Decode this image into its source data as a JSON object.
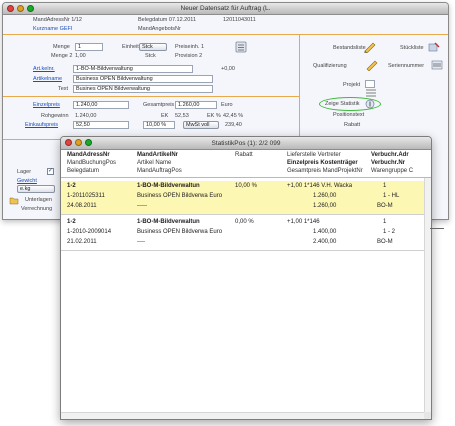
{
  "back_window": {
    "title": "Neuer Datensatz für Auftrag (L.",
    "top": {
      "mandadressnr": "MandAdressNr 1/12",
      "belegdatum": "Belegdatum 07.12.2011",
      "belegnr": "12011043011",
      "kurzname": "Kurzname GEFI",
      "mandangebotsnr": "MandAngebotsNr"
    },
    "fields": {
      "menge_label": "Menge",
      "menge_value": "1",
      "einheit_label": "Einheit",
      "einheit_value": "Stck",
      "preiseinh_label": "Preiseinh. 1",
      "menge2_label": "Menge 2",
      "menge2_value": "1,00",
      "einheit2_value": "Stck",
      "provision_label": "Provision 2",
      "artikelnr_label": "Art.kelnr.",
      "artikelnr_value": "1-BO-M-Bildverwaltung",
      "artikelnr_extra": "+0,00",
      "artikelname_label": "Artikelname",
      "artikelname_value": "Business OPEN Bildverwaltung",
      "text_label": "Text",
      "text_value": "Busines OPEN Bildverwaltung",
      "einzelpreis_label": "Einzelpreis",
      "einzelpreis_value": "1.240,00",
      "gesamtpreis_label": "Gesamtpreis",
      "gesamtpreis_value": "1.260,00",
      "euro_label": "Euro",
      "rohgewinn_label": "Rohgewinn",
      "rohgewinn_value": "1.240,00",
      "ek_label": "EK",
      "ek_value": "52,53",
      "ekpct_label": "EK %",
      "ekpct_value": "42,45 %",
      "einkaufspreis_label": "Einkaufspreis",
      "einkaufspreis_value": "52,50",
      "rabatt_value": "10,00 %",
      "mwst_value": "MwSt voll",
      "sum_value": "239,40"
    },
    "right": {
      "bestandsliste": "Bestandsliste",
      "stueckliste": "Stückliste",
      "qualifikation": "Qualifizierung",
      "seriennummer": "Seriennummer",
      "projekt": "Projekt",
      "zeige_statistik": "Zeige Statistik",
      "positionstext": "Positionstext",
      "rabatt2": "Rabatt"
    },
    "bottom_left": {
      "lager_label": "Lager",
      "gewicht_label": "Gewicht",
      "einh_value": "e.kg",
      "unterlagen": "Unterlagen",
      "verrechnung": "Verrechnung"
    }
  },
  "front_window": {
    "title": "StatistikPos (1): 2/2 099",
    "header": {
      "row1": [
        "MandAdressNr",
        "MandArtikelNr",
        "Rabatt",
        "Lieferstelle Vertreter",
        "Verbuchr.Adr"
      ],
      "row2": [
        "MandBuchungPos",
        "Artikel Name",
        "Einzelpreis Kostenträger",
        "Verbuchr.Nr"
      ],
      "row3": [
        "Belegdatum",
        "MandAuftragPos",
        "Gesamtpreis MandProjektNr",
        "Warengruppe C"
      ]
    },
    "records": [
      {
        "highlight": true,
        "line1": [
          "1-2",
          "1-BO-M-Bildverwaltun",
          "10,00 %",
          "+1,00 1*146 V.H. Wacka",
          "1"
        ],
        "line2": [
          "1-2011025311",
          "Business OPEN Bildverwa Euro",
          "1.260,00",
          "1 - HL"
        ],
        "line3": [
          "24.08.2011",
          "-----",
          "1.260,00",
          "BO-M"
        ]
      },
      {
        "highlight": false,
        "line1": [
          "1-2",
          "1-BO-M-Bildverwaltun",
          "0,00 %",
          "+1,00 1*146",
          "1"
        ],
        "line2": [
          "1-2010-2009014",
          "Business OPEN Bildverwa Euro",
          "1.400,00",
          "1 - 2"
        ],
        "line3": [
          "21.02.2011",
          "----",
          "2.400,00",
          "BO-M"
        ]
      }
    ]
  },
  "colors": {
    "highlight_row": "#fdf7b4",
    "link_blue": "#1b4fb8",
    "divider_orange": "#e7a94a",
    "callout_green": "#3cbb3c"
  }
}
